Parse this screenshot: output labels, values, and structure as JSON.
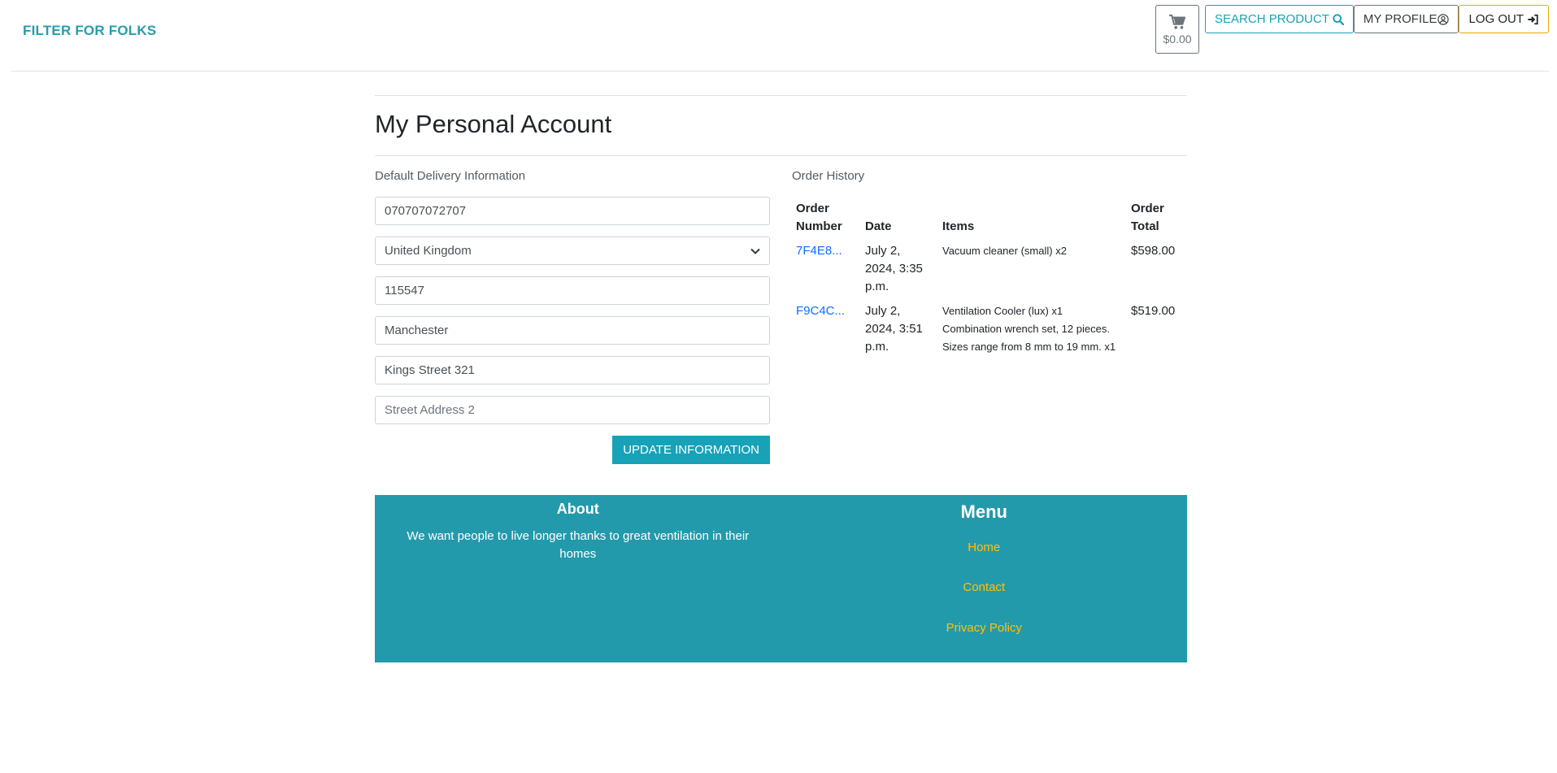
{
  "header": {
    "brand": "FILTER FOR FOLKS",
    "cart_total": "$0.00",
    "search_label": "SEARCH PRODUCT",
    "profile_label": "MY PROFILE",
    "logout_label": "LOG OUT"
  },
  "page": {
    "title": "My Personal Account"
  },
  "delivery": {
    "section_label": "Default Delivery Information",
    "phone": "070707072707",
    "country": "United Kingdom",
    "postcode": "115547",
    "city": "Manchester",
    "street1": "Kings Street 321",
    "street2_placeholder": "Street Address 2",
    "update_label": "UPDATE INFORMATION"
  },
  "orders": {
    "section_label": "Order History",
    "columns": [
      "Order Number",
      "Date",
      "Items",
      "Order Total"
    ],
    "rows": [
      {
        "number": "7F4E8...",
        "date": "July 2, 2024, 3:35 p.m.",
        "items": [
          "Vacuum cleaner (small) x2"
        ],
        "total": "$598.00"
      },
      {
        "number": "F9C4C...",
        "date": "July 2, 2024, 3:51 p.m.",
        "items": [
          "Ventilation Cooler (lux) x1",
          "Combination wrench set, 12 pieces. Sizes range from 8 mm to 19 mm. x1"
        ],
        "total": "$519.00"
      }
    ]
  },
  "footer": {
    "about_title": "About",
    "about_text": "We want people to live longer thanks to great ventilation in their homes",
    "menu_title": "Menu",
    "links": [
      "Home",
      "Contact",
      "Privacy Policy"
    ]
  },
  "colors": {
    "accent": "#17a2b8",
    "footer_bg": "#239aab",
    "link": "#0d6efd",
    "footer_link": "#ffc107"
  }
}
